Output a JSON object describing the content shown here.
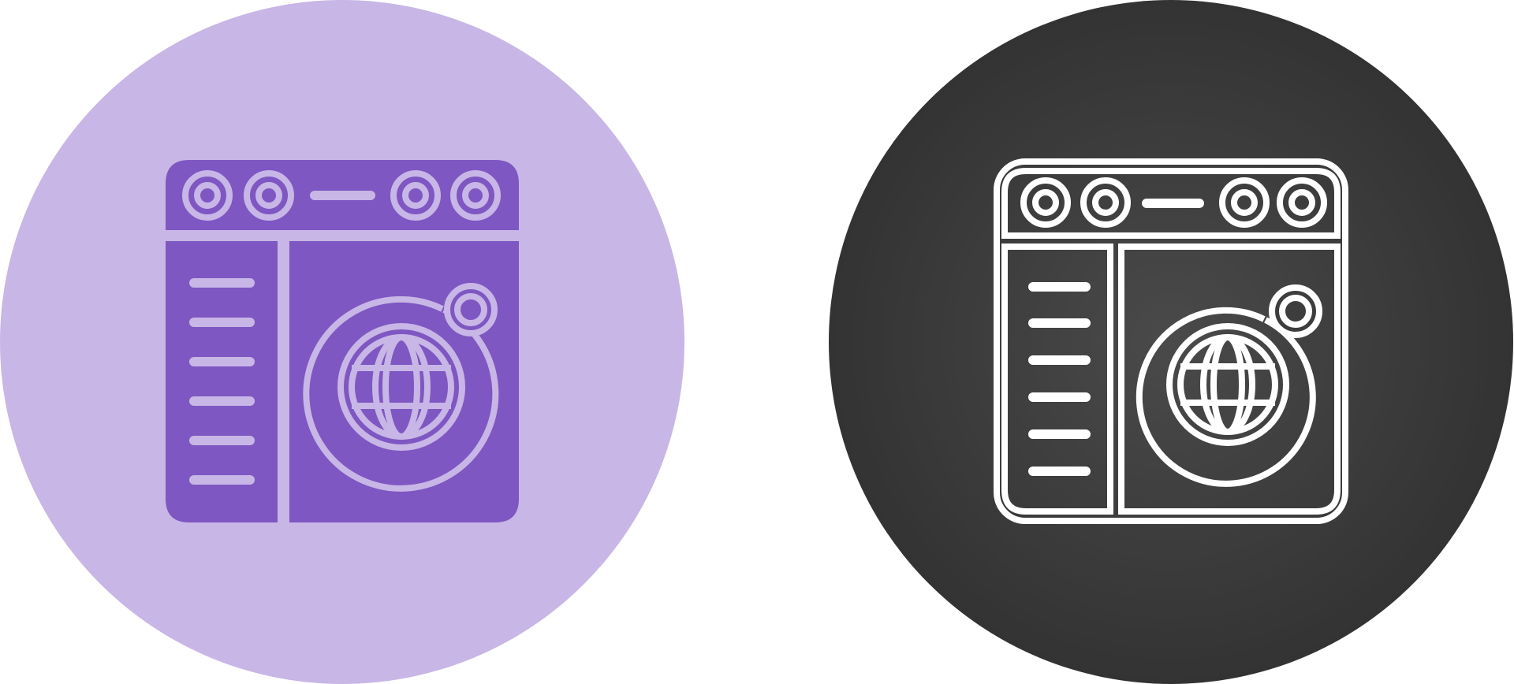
{
  "icons": [
    {
      "name": "web-browser-globe-icon-glyph",
      "style": "glyph",
      "circle_color": "#c8b6e6",
      "fill_color": "#7e57c2",
      "line_color": "#c8b6e6"
    },
    {
      "name": "web-browser-globe-icon-outline",
      "style": "outline",
      "circle_color_center": "#4a4a4a",
      "circle_color_edge": "#333333",
      "line_color": "#ffffff"
    }
  ]
}
